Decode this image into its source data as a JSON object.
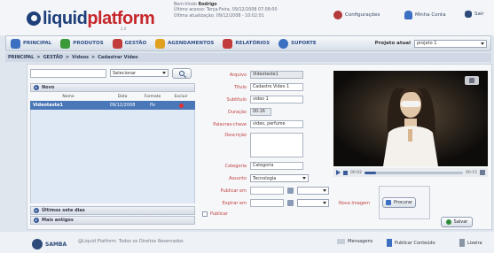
{
  "header": {
    "logo_text_main": "liquid",
    "logo_text_accent": "platform",
    "logo_version": "2.0",
    "user_line1_label": "Bem-Vindo",
    "user_line1_value": "Rodrigo",
    "user_line2": "Último acesso: Terça-Feira, 09/12/2008 07:08:00",
    "user_line3": "Última atualização: 09/12/2008 - 10:02:01",
    "configuracoes": "Configurações",
    "minha_conta": "Minha Conta",
    "sair": "Sair"
  },
  "nav": {
    "items": [
      {
        "label": "Principal",
        "color": "#3a6fc1"
      },
      {
        "label": "Produtos",
        "color": "#3a9a3a"
      },
      {
        "label": "Gestão",
        "color": "#c23c3c"
      },
      {
        "label": "Agendamentos",
        "color": "#e0a020"
      },
      {
        "label": "Relatórios",
        "color": "#c23c3c"
      },
      {
        "label": "Suporte",
        "color": "#3a6fc1"
      }
    ],
    "project_label": "Projeto atual",
    "project_value": "projeto 1"
  },
  "breadcrumb": [
    "PRINCIPAL",
    "GESTÃO",
    "Vídeos",
    "Cadastrar Vídeo"
  ],
  "list": {
    "filter_value": "Selecionar",
    "section_new": "Novo",
    "columns": [
      "Nome",
      "Data",
      "Formato",
      "Excluir"
    ],
    "rows": [
      {
        "name": "Videoteste1",
        "date": "09/12/2008",
        "format": "flv"
      }
    ],
    "section_last_days": "Últimos sete dias",
    "section_older": "Mais antigos"
  },
  "form": {
    "arquivo_label": "Arquivo",
    "arquivo_value": "Videoteste1",
    "titulo_label": "Título",
    "titulo_value": "Cadastro Video 1",
    "subtitulo_label": "Subtítulo",
    "subtitulo_value": "video 1",
    "duracao_label": "Duração",
    "duracao_value": "00:16",
    "palavras_label": "Palavras-chave",
    "palavras_value": "video, perfume",
    "descricao_label": "Descrição",
    "categoria_label": "Categoria",
    "categoria_value": "Categoria",
    "assunto_label": "Assunto",
    "assunto_value": "Tecnologia",
    "publicar_em_label": "Publicar em",
    "expirar_em_label": "Expirar em",
    "publicar_label": "Publicar",
    "nova_imagem_label": "Nova Imagem",
    "procurar_label": "Procurar",
    "salvar_label": "Salvar"
  },
  "player": {
    "time_current": "00:02",
    "time_total": "00:15",
    "progress": 0.12
  },
  "footer": {
    "brand": "SAMBA",
    "copyright": "@Liquid Platform. Todos os Direitos Reservados",
    "mensagens": "Mensagens",
    "publicar_conteudo": "Publicar Conteúdo",
    "lixeira": "Lixeira"
  }
}
